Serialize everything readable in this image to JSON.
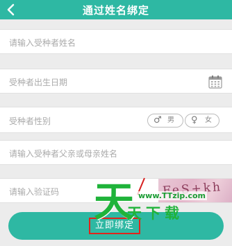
{
  "header": {
    "title": "通过姓名绑定",
    "back_icon": "chevron-left-icon",
    "color": "#2eb8a3"
  },
  "form": {
    "name_placeholder": "请输入受种者姓名",
    "birthdate_placeholder": "受种者出生日期",
    "calendar_icon": "calendar-icon",
    "gender_label": "受种者性别",
    "gender_male": "男",
    "gender_female": "女",
    "parent_name_placeholder": "请输入受种者父亲或母亲姓名",
    "captcha_placeholder": "请输入验证码",
    "captcha_image_text": "FeS+kh"
  },
  "submit": {
    "label": "立即绑定",
    "color": "#2eb8a3",
    "highlight_color": "#e2231a"
  },
  "watermark": {
    "big_char": "天",
    "url": "www.TTzip.com",
    "name": "天下载",
    "color": "#1fb33a"
  }
}
